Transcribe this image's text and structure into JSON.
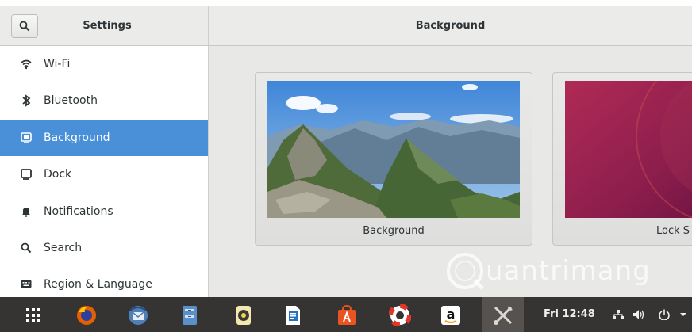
{
  "header": {
    "sidebar_title": "Settings",
    "main_title": "Background",
    "search_icon": "search-icon"
  },
  "sidebar": {
    "items": [
      {
        "label": "Wi-Fi",
        "icon": "wifi-icon"
      },
      {
        "label": "Bluetooth",
        "icon": "bluetooth-icon"
      },
      {
        "label": "Background",
        "icon": "background-icon",
        "active": true
      },
      {
        "label": "Dock",
        "icon": "dock-icon"
      },
      {
        "label": "Notifications",
        "icon": "bell-icon"
      },
      {
        "label": "Search",
        "icon": "search-icon"
      },
      {
        "label": "Region & Language",
        "icon": "keyboard-icon"
      }
    ]
  },
  "main": {
    "cards": [
      {
        "label": "Background"
      },
      {
        "label": "Lock S"
      }
    ]
  },
  "watermark": {
    "text": "uantrimang"
  },
  "taskbar": {
    "apps": [
      "app-grid-icon",
      "firefox-icon",
      "thunderbird-icon",
      "files-icon",
      "rhythmbox-icon",
      "writer-icon",
      "software-center-icon",
      "help-icon",
      "amazon-icon",
      "settings-tools-icon"
    ],
    "clock": "Fri 12:48",
    "tray": [
      "network-icon",
      "volume-icon",
      "power-icon",
      "dropdown-arrow-icon"
    ]
  },
  "colors": {
    "accent": "#4a90d9",
    "taskbar": "#353432",
    "header": "#ebebea"
  }
}
